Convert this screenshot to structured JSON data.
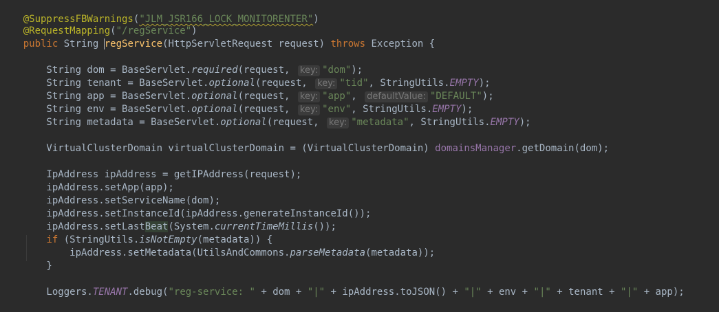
{
  "code": {
    "line1": {
      "at_annotation": "@SuppressFBWarnings",
      "open_paren": "(",
      "value": "\"JLM_JSR166_LOCK_MONITORENTER\"",
      "close_paren": ")"
    },
    "line2": {
      "at_annotation": "@RequestMapping",
      "open_paren": "(",
      "value": "\"/regService\"",
      "close_paren": ")"
    },
    "line3": {
      "kw_public": "public",
      "ret_type": " String ",
      "method_name": "regService",
      "params": "(HttpServletRequest request) ",
      "kw_throws": "throws",
      "tail": " Exception {"
    },
    "line5": {
      "prefix": "    String dom = BaseServlet.",
      "method": "required",
      "args_open": "(request, ",
      "hint_key": "key:",
      "arg_value": "\"dom\"",
      "tail": ");"
    },
    "line6": {
      "prefix": "    String tenant = BaseServlet.",
      "method": "optional",
      "args_open": "(request, ",
      "hint_key": "key:",
      "arg_value": "\"tid\"",
      "mid": ", StringUtils.",
      "const": "EMPTY",
      "tail": ");"
    },
    "line7": {
      "prefix": "    String app = BaseServlet.",
      "method": "optional",
      "args_open": "(request, ",
      "hint_key": "key:",
      "arg_value": "\"app\"",
      "mid": ", ",
      "hint_default": "defaultValue:",
      "arg_default": "\"DEFAULT\"",
      "tail": ");"
    },
    "line8": {
      "prefix": "    String env = BaseServlet.",
      "method": "optional",
      "args_open": "(request, ",
      "hint_key": "key:",
      "arg_value": "\"env\"",
      "mid": ", StringUtils.",
      "const": "EMPTY",
      "tail": ");"
    },
    "line9": {
      "prefix": "    String metadata = BaseServlet.",
      "method": "optional",
      "args_open": "(request, ",
      "hint_key": "key:",
      "arg_value": "\"metadata\"",
      "mid": ", StringUtils.",
      "const": "EMPTY",
      "tail": ");"
    },
    "line11": {
      "prefix": "    VirtualClusterDomain virtualClusterDomain = (VirtualClusterDomain) ",
      "field": "domainsManager",
      "tail": ".getDomain(dom);"
    },
    "line13": "    IpAddress ipAddress = getIPAddress(request);",
    "line14": "    ipAddress.setApp(app);",
    "line15": "    ipAddress.setServiceName(dom);",
    "line16": "    ipAddress.setInstanceId(ipAddress.generateInstanceId());",
    "line17": {
      "prefix": "    ipAddress.setLast",
      "highlight": "Beat",
      "mid": "(System.",
      "italic_method": "currentTimeMillis",
      "tail": "());"
    },
    "line18": {
      "indent": "    ",
      "kw_if": "if",
      "mid": " (StringUtils.",
      "italic_method": "isNotEmpty",
      "tail": "(metadata)) {"
    },
    "line19": {
      "prefix": "        ipAddress.setMetadata(UtilsAndCommons.",
      "italic_method": "parseMetadata",
      "tail": "(metadata));"
    },
    "line20": "    }",
    "line22": {
      "prefix": "    Loggers.",
      "const": "TENANT",
      "mid1": ".debug(",
      "s1": "\"reg-service: \"",
      "mid2": " + dom + ",
      "s2": "\"|\"",
      "mid3": " + ipAddress.toJSON() + ",
      "s3": "\"|\"",
      "mid4": " + env + ",
      "s4": "\"|\"",
      "mid5": " + tenant + ",
      "s5": "\"|\"",
      "tail": " + app);"
    }
  },
  "colors": {
    "background": "#2b2b2b",
    "default_text": "#a9b7c6",
    "annotation": "#bbb529",
    "string": "#6a8759",
    "keyword": "#cc7832",
    "method_declaration": "#ffc66d",
    "field": "#9876aa",
    "hint_text": "#787878"
  }
}
